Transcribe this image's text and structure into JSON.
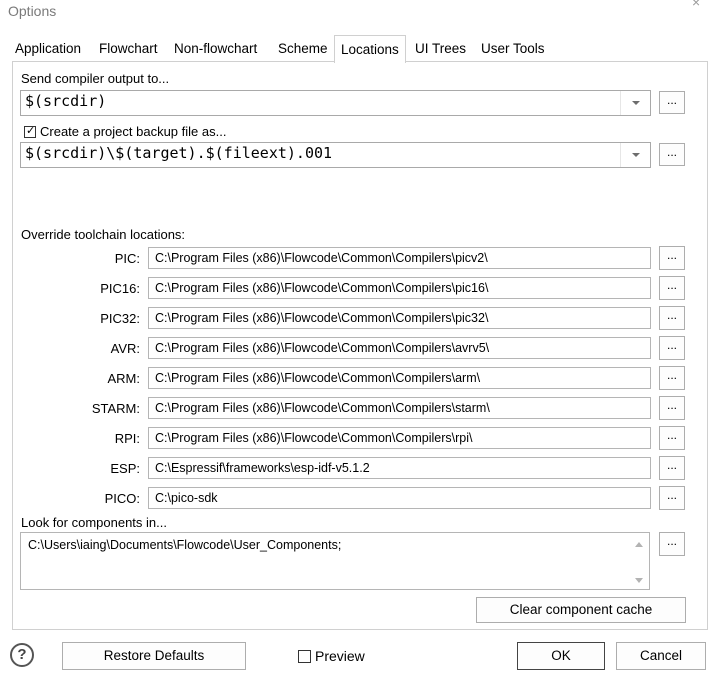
{
  "window": {
    "title": "Options",
    "close_glyph": "×"
  },
  "tabs": [
    {
      "label": "Application"
    },
    {
      "label": "Flowchart"
    },
    {
      "label": "Non-flowchart"
    },
    {
      "label": "Scheme"
    },
    {
      "label": "Locations"
    },
    {
      "label": "UI Trees"
    },
    {
      "label": "User Tools"
    }
  ],
  "active_tab": "Locations",
  "compiler_output": {
    "label": "Send compiler output to...",
    "value": "$(srcdir)",
    "browse": "..."
  },
  "backup": {
    "checkbox_label": "Create a project backup file as...",
    "checked": true,
    "value": "$(srcdir)\\$(target).$(fileext).001",
    "browse": "..."
  },
  "toolchain": {
    "label": "Override toolchain locations:",
    "rows": [
      {
        "name": "PIC:",
        "path": "C:\\Program Files (x86)\\Flowcode\\Common\\Compilers\\picv2\\",
        "browse": "..."
      },
      {
        "name": "PIC16:",
        "path": "C:\\Program Files (x86)\\Flowcode\\Common\\Compilers\\pic16\\",
        "browse": "..."
      },
      {
        "name": "PIC32:",
        "path": "C:\\Program Files (x86)\\Flowcode\\Common\\Compilers\\pic32\\",
        "browse": "..."
      },
      {
        "name": "AVR:",
        "path": "C:\\Program Files (x86)\\Flowcode\\Common\\Compilers\\avrv5\\",
        "browse": "..."
      },
      {
        "name": "ARM:",
        "path": "C:\\Program Files (x86)\\Flowcode\\Common\\Compilers\\arm\\",
        "browse": "..."
      },
      {
        "name": "STARM:",
        "path": "C:\\Program Files (x86)\\Flowcode\\Common\\Compilers\\starm\\",
        "browse": "..."
      },
      {
        "name": "RPI:",
        "path": "C:\\Program Files (x86)\\Flowcode\\Common\\Compilers\\rpi\\",
        "browse": "..."
      },
      {
        "name": "ESP:",
        "path": "C:\\Espressif\\frameworks\\esp-idf-v5.1.2",
        "browse": "..."
      },
      {
        "name": "PICO:",
        "path": "C:\\pico-sdk",
        "browse": "..."
      }
    ]
  },
  "components": {
    "label": "Look for components in...",
    "value": "C:\\Users\\iaing\\Documents\\Flowcode\\User_Components;",
    "browse": "..."
  },
  "clear_cache_label": "Clear component cache",
  "footer": {
    "help_glyph": "?",
    "restore_label": "Restore Defaults",
    "preview_label": "Preview",
    "preview_checked": false,
    "ok_label": "OK",
    "cancel_label": "Cancel"
  }
}
